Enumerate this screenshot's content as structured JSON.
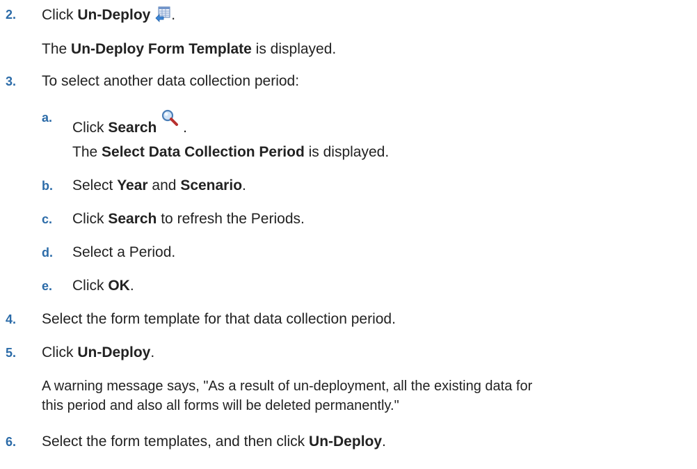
{
  "steps": [
    {
      "number": "2.",
      "parts": [
        "Click ",
        "Un-Deploy",
        "."
      ],
      "icon": "undeploy-icon",
      "result": [
        "The ",
        "Un-Deploy Form Template",
        " is displayed."
      ]
    },
    {
      "number": "3.",
      "text": "To select another data collection period:",
      "substeps": [
        {
          "letter": "a.",
          "parts": [
            "Click ",
            "Search",
            " ."
          ],
          "icon": "search-icon",
          "result": [
            "The ",
            "Select Data Collection Period",
            " is displayed."
          ]
        },
        {
          "letter": "b.",
          "parts": [
            "Select ",
            "Year",
            " and ",
            "Scenario",
            "."
          ]
        },
        {
          "letter": "c.",
          "parts": [
            "Click ",
            "Search",
            " to refresh the Periods."
          ]
        },
        {
          "letter": "d.",
          "text": "Select a Period."
        },
        {
          "letter": "e.",
          "parts": [
            "Click ",
            "OK",
            "."
          ]
        }
      ]
    },
    {
      "number": "4.",
      "text": "Select the form template for that data collection period."
    },
    {
      "number": "5.",
      "parts": [
        "Click ",
        "Un-Deploy",
        "."
      ],
      "result_line1": "A warning message says, \"As a result of un-deployment, all the existing data for",
      "result_line2": "this period and also all forms will be deleted permanently.\""
    },
    {
      "number": "6.",
      "parts": [
        "Select the form templates, and then click ",
        "Un-Deploy",
        "."
      ]
    }
  ],
  "colors": {
    "step_number": "#2b6ba8",
    "text": "#222222"
  }
}
